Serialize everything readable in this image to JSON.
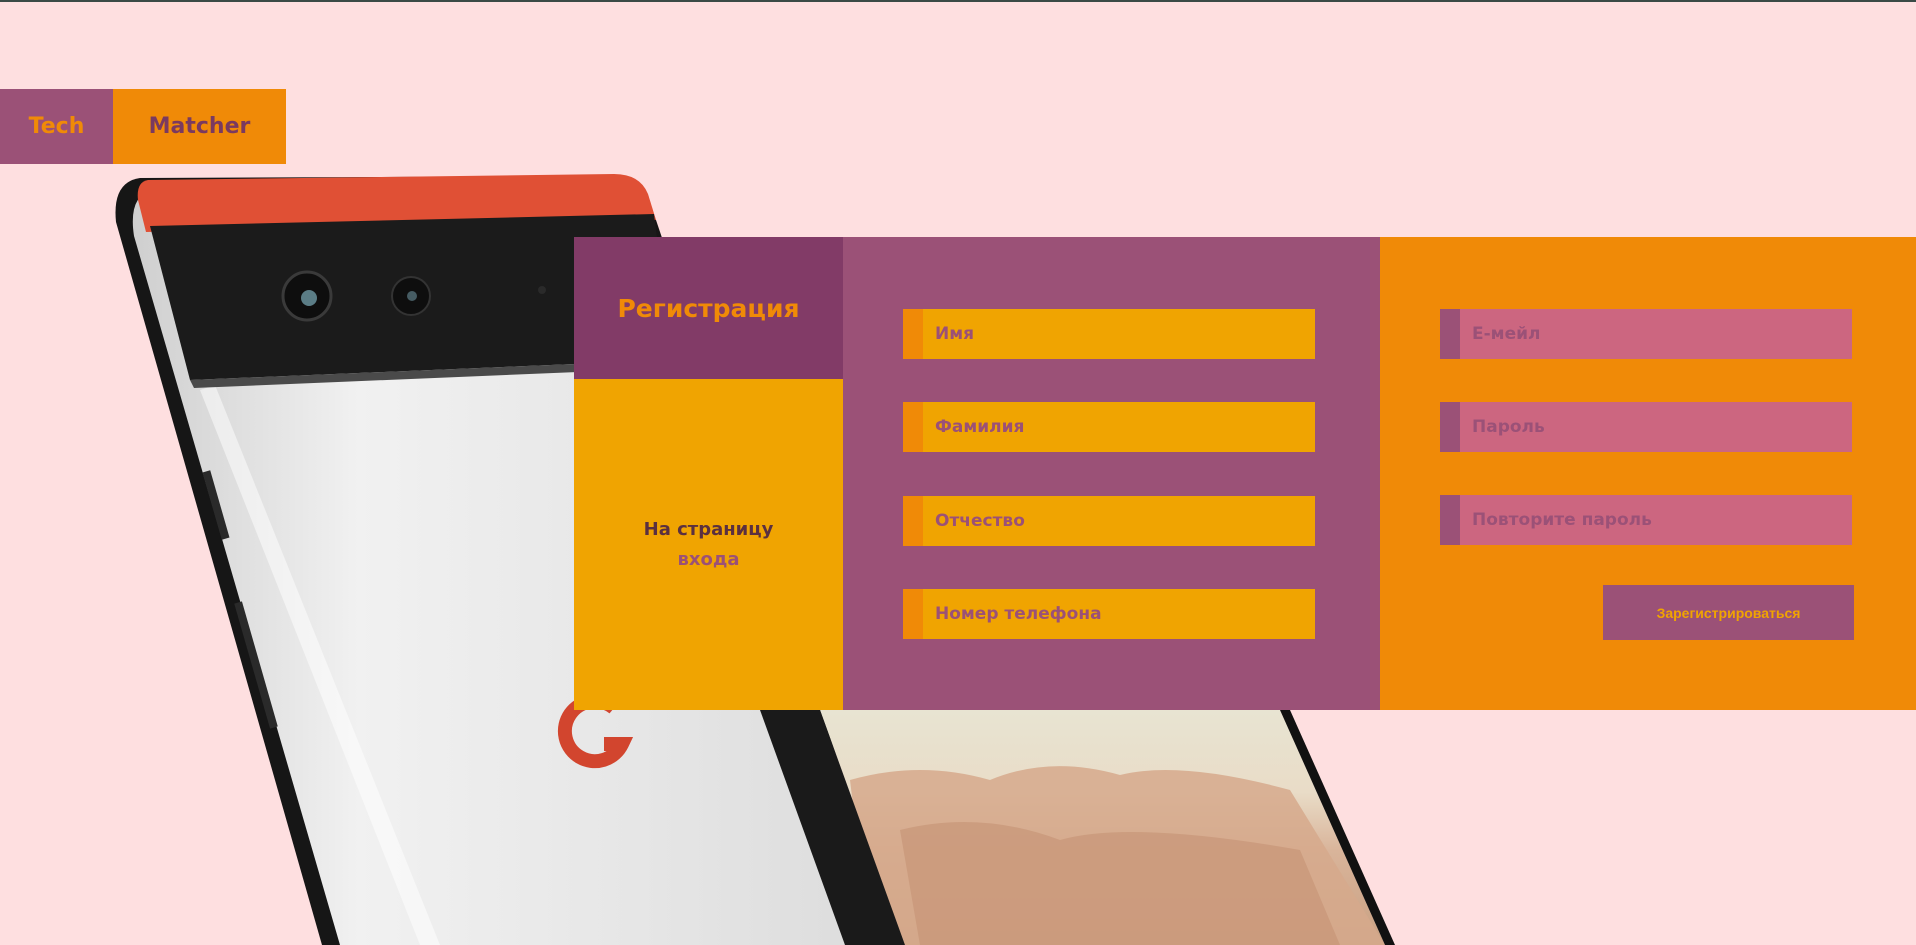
{
  "logo": {
    "part1": "Tech",
    "part2": "Matcher"
  },
  "registration": {
    "title": "Регистрация",
    "login_link": {
      "line1": "На страницу",
      "line2": "входа"
    },
    "fields": {
      "first_name": "Имя",
      "last_name": "Фамилия",
      "patronymic": "Отчество",
      "phone": "Номер телефона",
      "email": "Е-мейл",
      "password": "Пароль",
      "password_repeat": "Повторите пароль"
    },
    "submit_label": "Зарегистрироваться"
  },
  "colors": {
    "background": "#fedfe0",
    "purple": "#9b5177",
    "dark_purple": "#823b67",
    "orange": "#f08a07",
    "yellow": "#f0a401",
    "pink": "#cc6680"
  }
}
